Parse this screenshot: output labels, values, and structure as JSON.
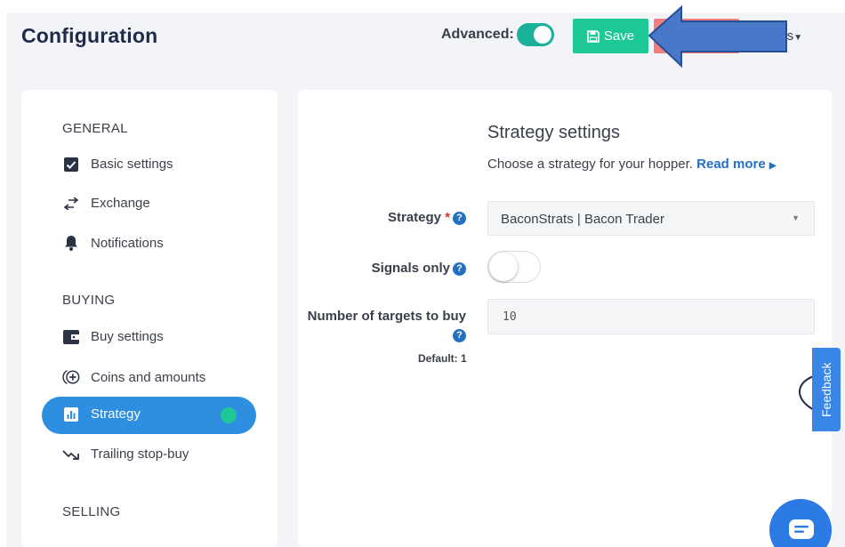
{
  "header": {
    "title": "Configuration",
    "advanced_label": "Advanced:",
    "advanced_on": true,
    "save_label": "Save",
    "options_label": "ons"
  },
  "sidebar": {
    "sections": [
      {
        "heading": "GENERAL",
        "items": [
          "Basic settings",
          "Exchange",
          "Notifications"
        ]
      },
      {
        "heading": "BUYING",
        "items": [
          "Buy settings",
          "Coins and amounts",
          "Strategy",
          "Trailing stop-buy"
        ]
      },
      {
        "heading": "SELLING",
        "items": []
      }
    ],
    "active_item": "Strategy"
  },
  "main": {
    "title": "Strategy settings",
    "description": "Choose a strategy for your hopper.",
    "read_more": "Read more",
    "strategy_label": "Strategy",
    "strategy_value": "BaconStrats | Bacon Trader",
    "signals_label": "Signals only",
    "signals_on": false,
    "targets_label": "Number of targets to buy",
    "targets_value": "10",
    "targets_default": "Default: 1"
  },
  "feedback_label": "Feedback",
  "colors": {
    "accent_green": "#1ec796",
    "toggle_teal": "#1ab09a",
    "active_blue": "#2e8fe0",
    "link_blue": "#2170c3",
    "danger_red": "#f17f7f",
    "arrow_blue": "#4a78c8"
  }
}
